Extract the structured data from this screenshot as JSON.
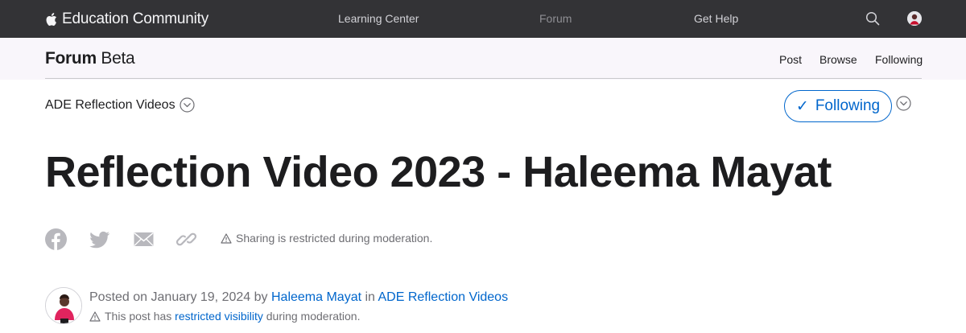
{
  "topnav": {
    "brand": "Education Community",
    "links": [
      "Learning Center",
      "Forum",
      "Get Help"
    ]
  },
  "subnav": {
    "title_strong": "Forum",
    "title_light": "Beta",
    "links": [
      "Post",
      "Browse",
      "Following"
    ]
  },
  "community": {
    "name": "ADE Reflection Videos"
  },
  "follow_button": {
    "label": "Following"
  },
  "post": {
    "title": "Reflection Video 2023 - Haleema Mayat",
    "share_note": "Sharing is restricted during moderation.",
    "posted_prefix": "Posted on",
    "date": "January 19, 2024",
    "by": "by",
    "author": "Haleema Mayat",
    "in": "in",
    "community_link": "ADE Reflection Videos",
    "mod_prefix": "This post has",
    "mod_link": "restricted visibility",
    "mod_suffix": "during moderation."
  },
  "colors": {
    "topnav_bg": "#333336",
    "subnav_bg": "#f9f6fb",
    "accent": "#0066cc",
    "text": "#1d1d1f",
    "muted": "#6e6e73",
    "icon_gray": "#b8b8bd"
  },
  "icons": [
    "apple-logo-icon",
    "search-icon",
    "profile-icon",
    "chevron-down-circle-icon",
    "checkmark-icon",
    "facebook-icon",
    "twitter-icon",
    "mail-icon",
    "link-icon",
    "warning-icon"
  ]
}
